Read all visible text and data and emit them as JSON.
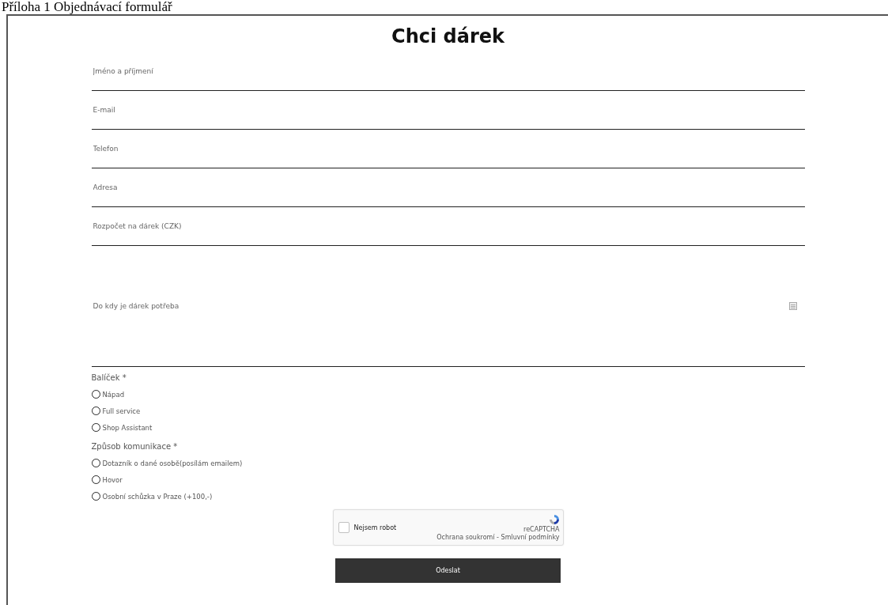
{
  "caption": "Příloha 1 Objednávací formulář",
  "title": "Chci dárek",
  "fields": [
    {
      "placeholder": "Jméno a příjmení"
    },
    {
      "placeholder": "E-mail"
    },
    {
      "placeholder": "Telefon"
    },
    {
      "placeholder": "Adresa"
    },
    {
      "placeholder": "Rozpočet na dárek (CZK)"
    }
  ],
  "date_field": {
    "placeholder": "Do kdy je dárek potřeba"
  },
  "radio_groups": [
    {
      "label": "Balíček *",
      "options": [
        {
          "label": "Nápad",
          "selected": false
        },
        {
          "label": "Full service",
          "selected": false
        },
        {
          "label": "Shop Assistant",
          "selected": false
        }
      ]
    },
    {
      "label": "Způsob komunikace *",
      "options": [
        {
          "label": "Dotazník o dané osobě(posílám emailem)",
          "selected": false
        },
        {
          "label": "Hovor",
          "selected": false
        },
        {
          "label": "Osobní schůzka v Praze (+100,-)",
          "selected": false
        }
      ]
    }
  ],
  "captcha": {
    "label": "Nejsem robot",
    "checked": false,
    "brand": "reCAPTCHA",
    "links": "Ochrana soukromí - Smluvní podmínky"
  },
  "submit": "Odeslat"
}
